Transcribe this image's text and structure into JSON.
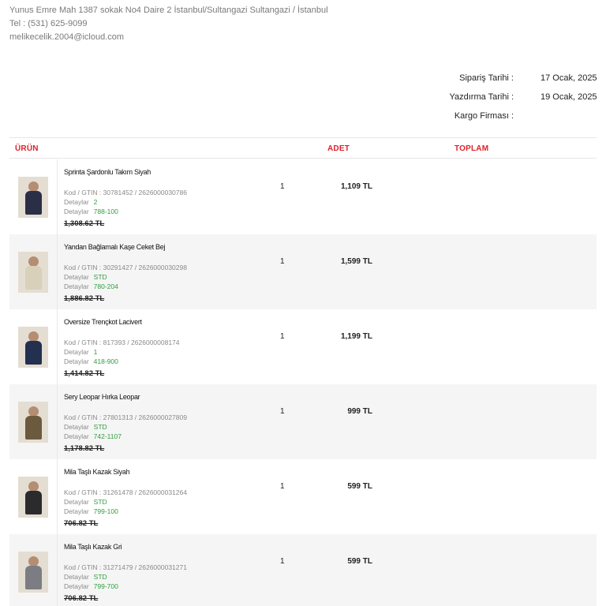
{
  "header": {
    "address": "Yunus Emre Mah 1387 sokak No4 Daire 2 İstanbul/Sultangazi Sultangazi / İstanbul",
    "phone": "Tel : (531) 625-9099",
    "email": "melikecelik.2004@icloud.com"
  },
  "meta": {
    "order_date_label": "Sipariş Tarihi :",
    "order_date": "17 Ocak, 2025",
    "print_date_label": "Yazdırma Tarihi :",
    "print_date": "19 Ocak, 2025",
    "cargo_label": "Kargo Firması :",
    "cargo_value": ""
  },
  "table": {
    "col_product": "ÜRÜN",
    "col_qty": "ADET",
    "col_total": "TOPLAM",
    "kod_prefix": "Kod / GTIN : ",
    "detay_label": "Detaylar",
    "rows": [
      {
        "name": "Sprinta Şardonlu Takım Siyah",
        "kod": "30781452 / 2626000030786",
        "detail1": "2",
        "detail2": "788-100",
        "old_price": "1,308.62 TL",
        "qty": "1",
        "total": "1,109 TL",
        "color": "#2a2f45"
      },
      {
        "name": "Yandan Bağlamalı Kaşe Ceket Bej",
        "kod": "30291427 / 2626000030298",
        "detail1": "STD",
        "detail2": "780-204",
        "old_price": "1,886.82 TL",
        "qty": "1",
        "total": "1,599 TL",
        "color": "#d8d0b8"
      },
      {
        "name": "Oversize Trençkot Lacivert",
        "kod": "817393 / 2626000008174",
        "detail1": "1",
        "detail2": "418-900",
        "old_price": "1,414.82 TL",
        "qty": "1",
        "total": "1,199 TL",
        "color": "#23304f"
      },
      {
        "name": "Sery Leopar Hırka Leopar",
        "kod": "27801313 / 2626000027809",
        "detail1": "STD",
        "detail2": "742-1107",
        "old_price": "1,178.82 TL",
        "qty": "1",
        "total": "999 TL",
        "color": "#6b5a3e"
      },
      {
        "name": "Mila Taşlı Kazak Siyah",
        "kod": "31261478 / 2626000031264",
        "detail1": "STD",
        "detail2": "799-100",
        "old_price": "706.82 TL",
        "qty": "1",
        "total": "599 TL",
        "color": "#2b2b2e"
      },
      {
        "name": "Mila Taşlı Kazak Gri",
        "kod": "31271479 / 2626000031271",
        "detail1": "STD",
        "detail2": "799-700",
        "old_price": "706.82 TL",
        "qty": "1",
        "total": "599 TL",
        "color": "#7b7d82"
      }
    ]
  }
}
